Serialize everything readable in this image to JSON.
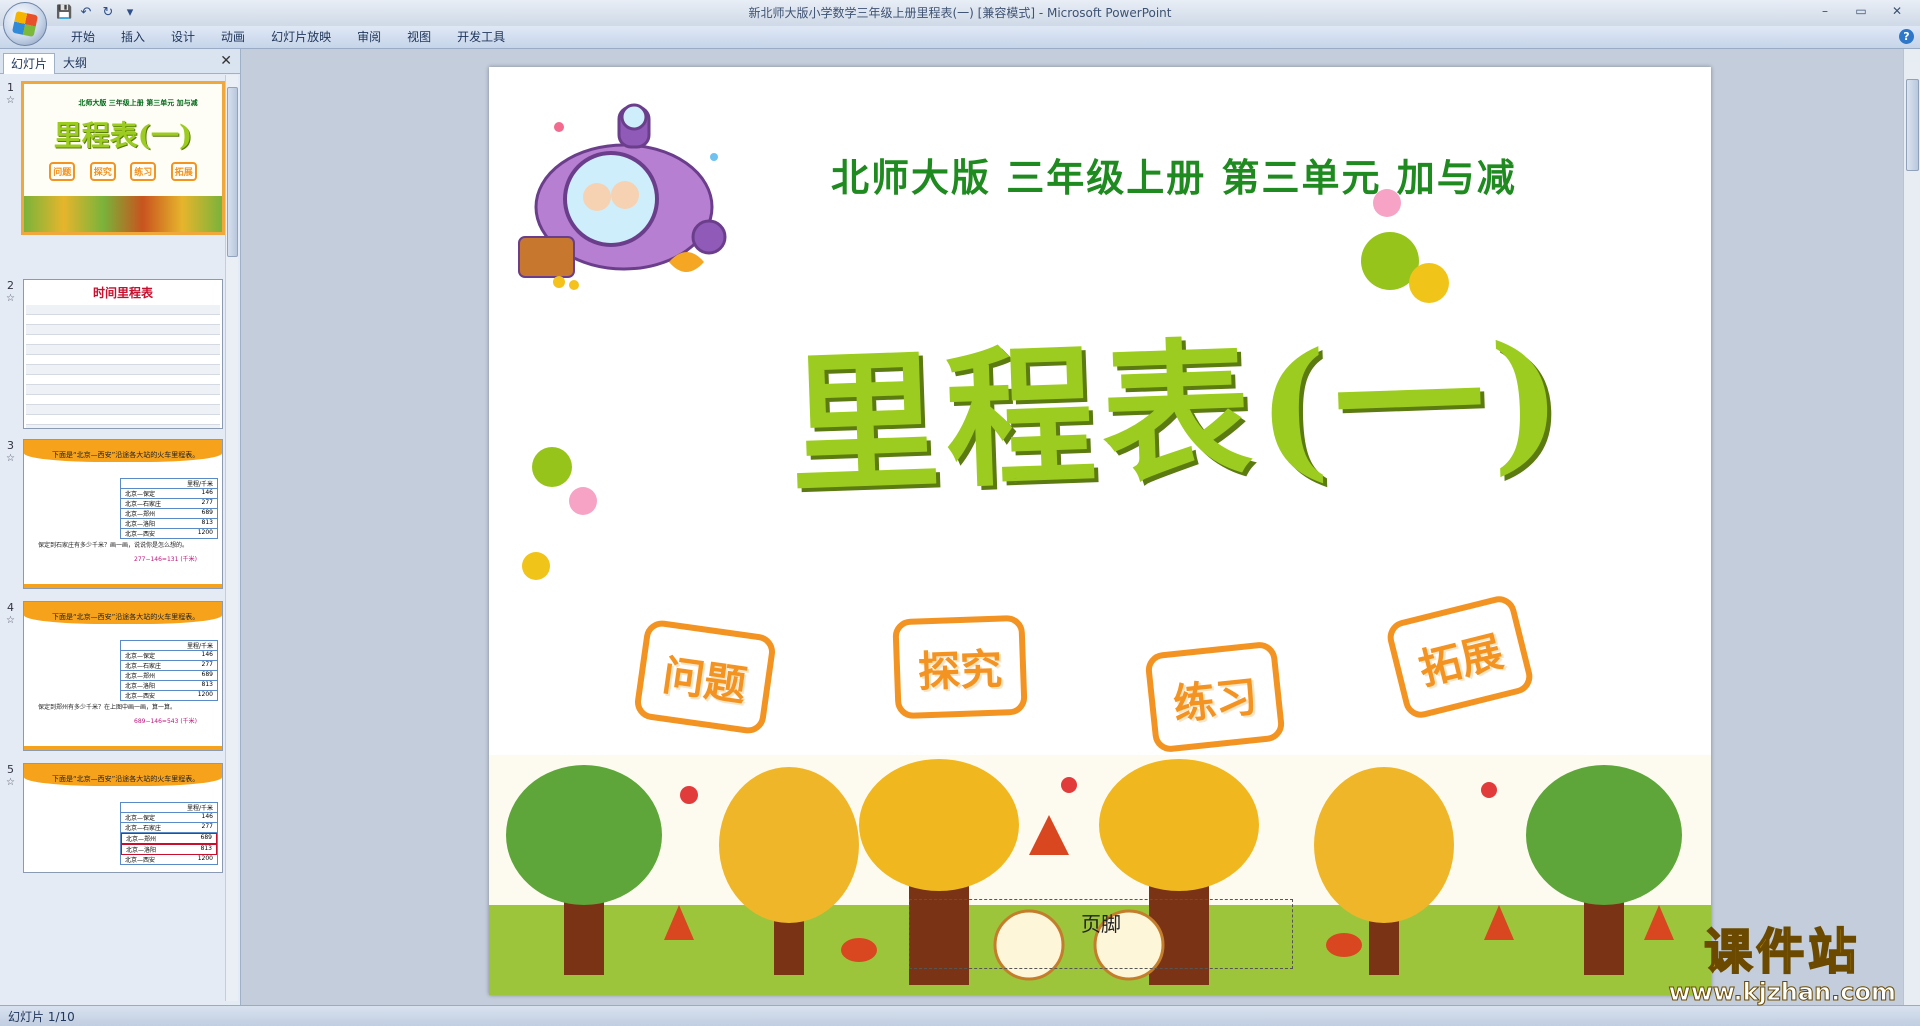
{
  "window": {
    "title": "新北师大版小学数学三年级上册里程表(一) [兼容模式] - Microsoft PowerPoint",
    "controls": [
      "–",
      "▭",
      "✕"
    ]
  },
  "quick_access": [
    {
      "icon": "save-icon",
      "glyph": "💾"
    },
    {
      "icon": "undo-icon",
      "glyph": "↶"
    },
    {
      "icon": "redo-icon",
      "glyph": "↻"
    },
    {
      "icon": "customize-icon",
      "glyph": "▾"
    }
  ],
  "ribbon": {
    "tabs": [
      "开始",
      "插入",
      "设计",
      "动画",
      "幻灯片放映",
      "审阅",
      "视图",
      "开发工具"
    ],
    "help": "?"
  },
  "pane": {
    "tab_slides": "幻灯片",
    "tab_outline": "大纲",
    "close": "✕"
  },
  "thumbnails": [
    {
      "num": "1",
      "subtitle": "北师大版  三年级上册  第三单元  加与减",
      "title": "里程表(一)",
      "tags": [
        "问题",
        "探究",
        "练习",
        "拓展"
      ]
    },
    {
      "num": "2",
      "title": "时间里程表"
    },
    {
      "num": "3",
      "title": "下面是“北京—西安”沿途各大站的火车里程表。",
      "table": [
        [
          "北京—保定",
          "146"
        ],
        [
          "北京—石家庄",
          "277"
        ],
        [
          "北京—郑州",
          "689"
        ],
        [
          "北京—洛阳",
          "813"
        ],
        [
          "北京—西安",
          "1200"
        ]
      ],
      "header": "里程/千米",
      "q": "保定到石家庄有多少千米？画一画，说说你是怎么想的。",
      "ans": "277−146=131 (千米)"
    },
    {
      "num": "4",
      "title": "下面是“北京—西安”沿途各大站的火车里程表。",
      "table": [
        [
          "北京—保定",
          "146"
        ],
        [
          "北京—石家庄",
          "277"
        ],
        [
          "北京—郑州",
          "689"
        ],
        [
          "北京—洛阳",
          "813"
        ],
        [
          "北京—西安",
          "1200"
        ]
      ],
      "header": "里程/千米",
      "q": "保定到郑州有多少千米？在上图中画一画，算一算。",
      "ans": "689−146=543 (千米)"
    },
    {
      "num": "5",
      "title": "下面是“北京—西安”沿途各大站的火车里程表。",
      "table": [
        [
          "北京—保定",
          "146"
        ],
        [
          "北京—石家庄",
          "277"
        ],
        [
          "北京—郑州",
          "689"
        ],
        [
          "北京—洛阳",
          "813"
        ],
        [
          "北京—西安",
          "1200"
        ]
      ],
      "header": "里程/千米"
    }
  ],
  "slide": {
    "subtitle": "北师大版  三年级上册  第三单元  加与减",
    "title": "里程表(一)",
    "tags": [
      "问题",
      "探究",
      "练习",
      "拓展"
    ],
    "footer_placeholder": "页脚"
  },
  "status": {
    "slide_counter": "幻灯片 1/10"
  },
  "watermark": {
    "cn": "课件站",
    "url": "www.kjzhan.com"
  },
  "colors": {
    "subtitle_green": "#1f8a1f",
    "title_green": "#9ccc1f",
    "tag_orange": "#f39321",
    "active_thumb_border": "#f0a73c"
  }
}
